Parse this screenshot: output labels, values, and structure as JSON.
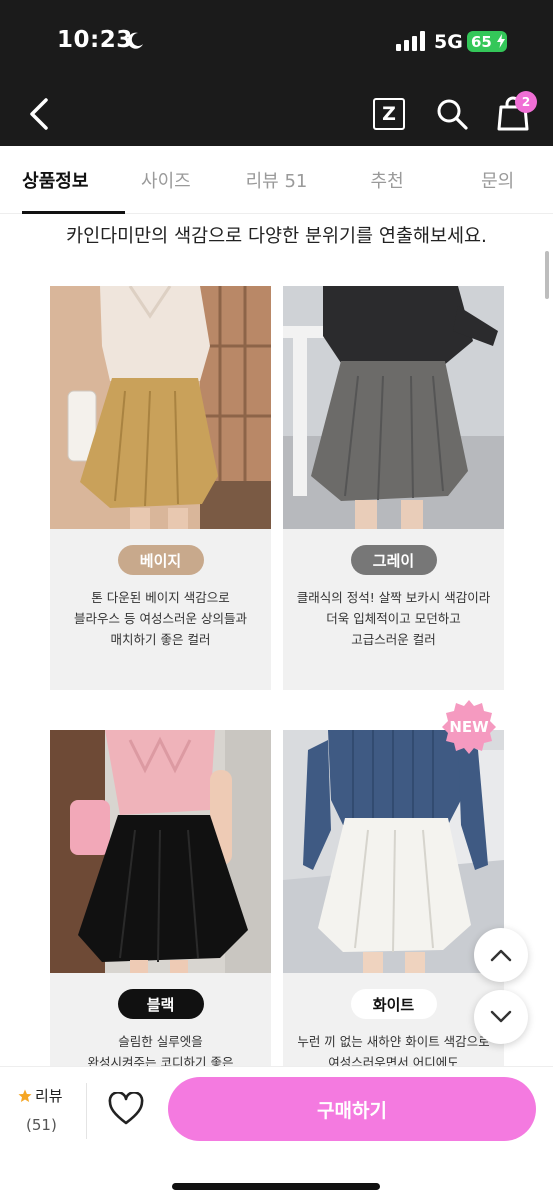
{
  "status_bar": {
    "time": "10:23",
    "network": "5G",
    "battery": "65"
  },
  "header": {
    "z_label": "Z",
    "cart_count": "2"
  },
  "tabs": [
    {
      "label": "상품정보",
      "active": true
    },
    {
      "label": "사이즈",
      "active": false
    },
    {
      "label": "리뷰 51",
      "active": false
    },
    {
      "label": "추천",
      "active": false
    },
    {
      "label": "문의",
      "active": false
    }
  ],
  "intro_text": "카인다미만의 색감으로 다양한 분위기를 연출해보세요.",
  "colors": {
    "accent_pink": "#f47ae0",
    "pill_beige": "#c8a98c",
    "pill_gray": "#777777",
    "pill_black": "#111111",
    "pill_white": "#ffffff"
  },
  "products": [
    {
      "color_name": "베이지",
      "desc_lines": [
        "톤 다운된 베이지 색감으로",
        "블라우스 등 여성스러운 상의들과",
        "매치하기 좋은 컬러"
      ]
    },
    {
      "color_name": "그레이",
      "desc_lines": [
        "클래식의 정석! 살짝 보카시 색감이라",
        "더욱 입체적이고 모던하고",
        "고급스러운 컬러"
      ]
    },
    {
      "color_name": "블랙",
      "desc_lines": [
        "슬림한 실루엣을",
        "완성시켜주는 코디하기 좋은"
      ]
    },
    {
      "color_name": "화이트",
      "new_badge": "NEW",
      "desc_lines": [
        "누런 끼 없는 새하얀 화이트 색감으로",
        "여성스러우면서 어디에도"
      ]
    }
  ],
  "bottom_bar": {
    "review_label": "리뷰",
    "review_count": "(51)",
    "buy_label": "구매하기"
  }
}
